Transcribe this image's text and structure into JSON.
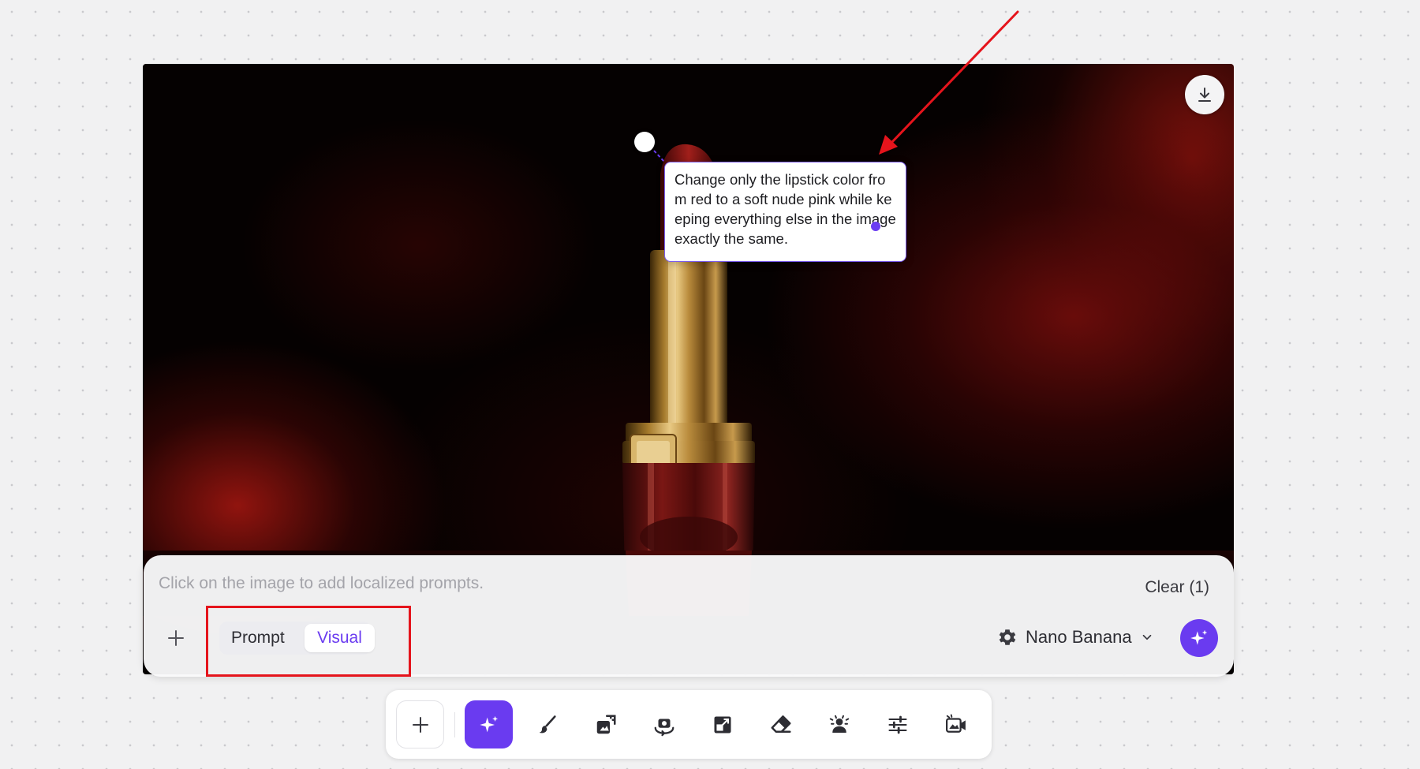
{
  "canvas": {
    "download_icon": "download-icon",
    "localized_prompt": {
      "text": "Change only the lipstick color from red to a soft nude pink while keeping everything else in the image exactly the same."
    }
  },
  "prompt_panel": {
    "hint": "Click on the image to add localized prompts.",
    "clear_label": "Clear (1)",
    "add_icon": "plus-icon",
    "modes": [
      {
        "label": "Prompt",
        "selected": false
      },
      {
        "label": "Visual",
        "selected": true
      }
    ],
    "model": {
      "icon": "gear-icon",
      "label": "Nano Banana",
      "chevron_icon": "chevron-down-icon"
    },
    "generate_icon": "sparkle-icon"
  },
  "toolbar": {
    "tools": [
      {
        "icon": "plus-icon",
        "active": false
      },
      {
        "icon": "sparkle-icon",
        "active": true
      },
      {
        "icon": "brush-icon",
        "active": false
      },
      {
        "icon": "image-resize-icon",
        "active": false
      },
      {
        "icon": "camera-rotate-icon",
        "active": false
      },
      {
        "icon": "expand-icon",
        "active": false
      },
      {
        "icon": "eraser-icon",
        "active": false
      },
      {
        "icon": "remove-background-icon",
        "active": false
      },
      {
        "icon": "adjustments-icon",
        "active": false
      },
      {
        "icon": "image-to-video-icon",
        "active": false
      }
    ]
  },
  "colors": {
    "accent": "#6a3bf0",
    "annotation_red": "#e5141c",
    "background": "#f1f1f2"
  }
}
